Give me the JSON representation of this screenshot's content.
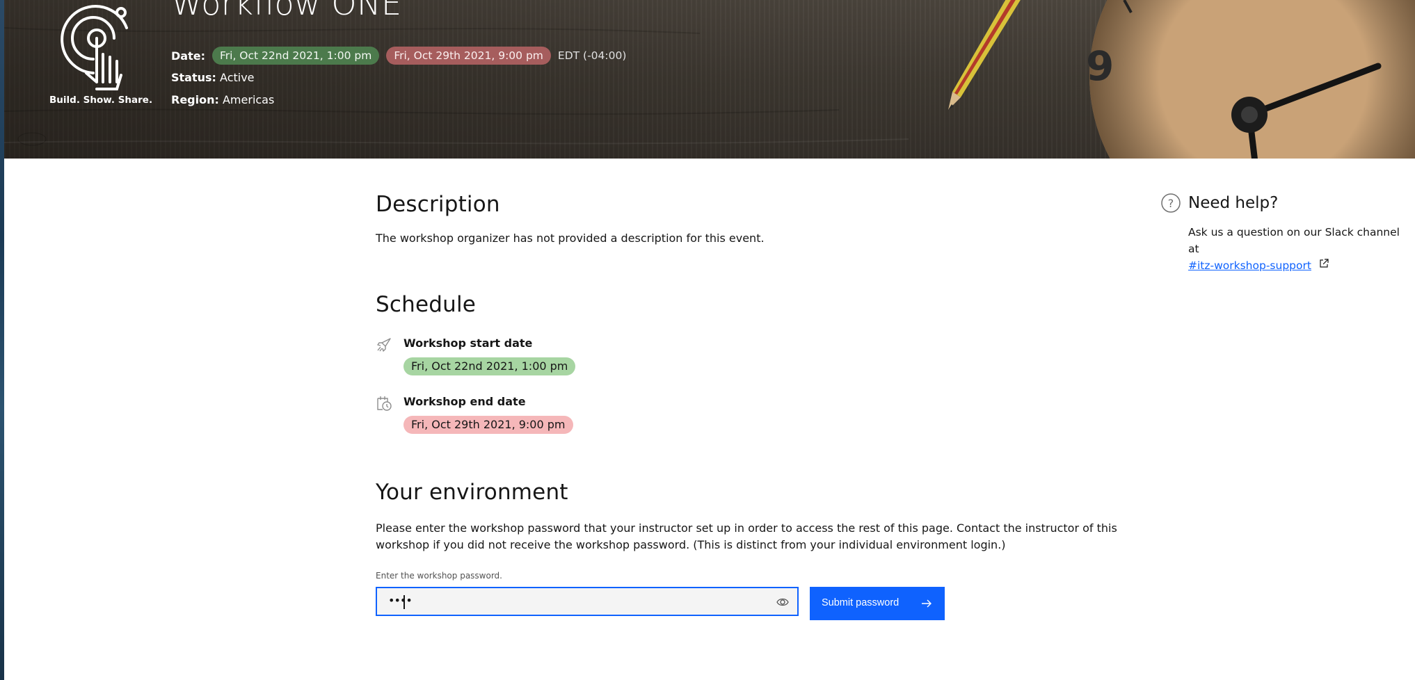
{
  "header": {
    "tagline": "Build. Show. Share.",
    "title": "Workflow ONE",
    "date_label": "Date:",
    "start_date": "Fri, Oct 22nd 2021, 1:00 pm",
    "end_date": "Fri, Oct 29th 2021, 9:00 pm",
    "timezone": "EDT (-04:00)",
    "status_label": "Status:",
    "status_value": "Active",
    "region_label": "Region:",
    "region_value": "Americas",
    "clock_numeral": "9"
  },
  "description": {
    "heading": "Description",
    "text": "The workshop organizer has not provided a description for this event."
  },
  "schedule": {
    "heading": "Schedule",
    "start": {
      "label": "Workshop start date",
      "value": "Fri, Oct 22nd 2021, 1:00 pm",
      "icon": "rocket-icon"
    },
    "end": {
      "label": "Workshop end date",
      "value": "Fri, Oct 29th 2021, 9:00 pm",
      "icon": "calendar-clock-icon"
    }
  },
  "environment": {
    "heading": "Your environment",
    "text": "Please enter the workshop password that your instructor set up in order to access the rest of this page. Contact the instructor of this workshop if you did not receive the workshop password. (This is distinct from your individual environment login.)",
    "password_label": "Enter the workshop password.",
    "password_value": "••••",
    "submit_label": "Submit password"
  },
  "help": {
    "title": "Need help?",
    "text": "Ask us a question on our Slack channel at",
    "link_text": "#itz-workshop-support"
  },
  "colors": {
    "primary": "#0f62fe",
    "start_pill_dark": "#4c7a4c",
    "end_pill_dark": "#a65d5d",
    "start_pill_light": "#a7d5a2",
    "end_pill_light": "#f5b7b9"
  }
}
